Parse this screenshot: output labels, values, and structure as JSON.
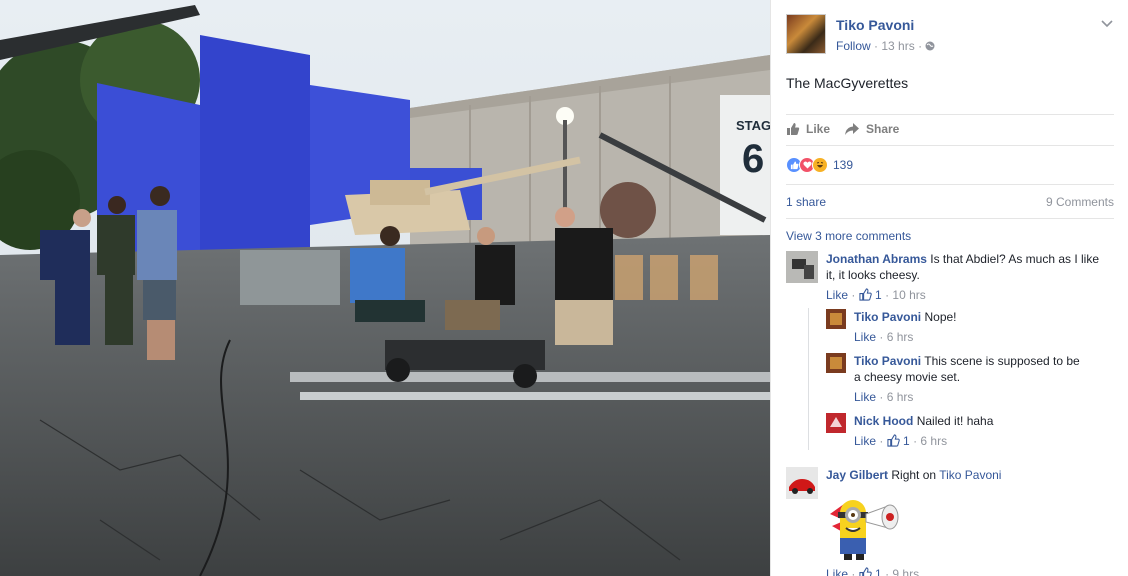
{
  "post": {
    "author": "Tiko Pavoni",
    "follow": "Follow",
    "time": "13 hrs",
    "caption": "The MacGyverettes"
  },
  "actions": {
    "like": "Like",
    "share": "Share"
  },
  "stats": {
    "reaction_count": "139",
    "shares": "1 share",
    "comments": "9 Comments",
    "view_more": "View 3 more comments"
  },
  "photo": {
    "sign_text_1": "STAG",
    "sign_text_2": "6"
  },
  "comments": [
    {
      "name": "Jonathan Abrams",
      "text_line1": "Is that Abdiel? As much as I like",
      "text_line2": "it, it looks cheesy.",
      "like": "Like",
      "likes": "1",
      "time": "10 hrs",
      "replies": [
        {
          "name": "Tiko Pavoni",
          "text_line1": "Nope!",
          "text_line2": "",
          "like": "Like",
          "likes": "",
          "time": "6 hrs"
        },
        {
          "name": "Tiko Pavoni",
          "text_line1": "This scene is supposed to be",
          "text_line2": "a cheesy movie set.",
          "like": "Like",
          "likes": "",
          "time": "6 hrs"
        },
        {
          "name": "Nick Hood",
          "text_line1": "Nailed it! haha",
          "text_line2": "",
          "like": "Like",
          "likes": "1",
          "time": "6 hrs"
        }
      ]
    },
    {
      "name": "Jay Gilbert",
      "text_line1": "Right on",
      "tag": "Tiko Pavoni",
      "like": "Like",
      "likes": "1",
      "time": "9 hrs"
    }
  ],
  "colors": {
    "link": "#365899",
    "muted": "#90949c",
    "like_blue": "#5890ff",
    "love_red": "#f25268",
    "haha_yellow": "#f7b125"
  }
}
